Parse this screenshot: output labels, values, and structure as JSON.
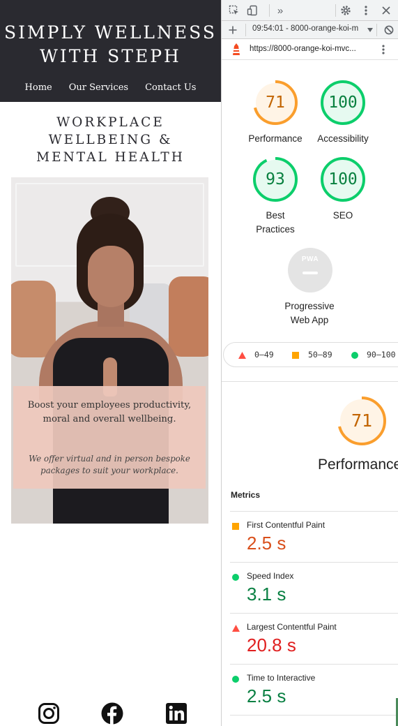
{
  "site": {
    "brand_line1": "SIMPLY WELLNESS",
    "brand_line2": "WITH STEPH",
    "nav": [
      {
        "label": "Home"
      },
      {
        "label": "Our Services"
      },
      {
        "label": "Contact Us"
      }
    ],
    "hero_line1": "WORKPLACE",
    "hero_line2": "WELLBEING &",
    "hero_line3": "MENTAL HEALTH",
    "overlay_p1": "Boost your employees productivity, moral and overall wellbeing.",
    "overlay_p2": "We offer virtual and in person bespoke packages to suit your workplace.",
    "social": [
      "instagram-icon",
      "facebook-icon",
      "linkedin-icon"
    ]
  },
  "devtools": {
    "more_tabs": "»",
    "report_label": "09:54:01 - 8000-orange-koi-m",
    "url": "https://8000-orange-koi-mvc...",
    "scores": {
      "performance": {
        "value": "71",
        "label": "Performance",
        "fraction": 0.71,
        "color": "#fa9e2d"
      },
      "accessibility": {
        "value": "100",
        "label": "Accessibility",
        "fraction": 1.0,
        "color": "#0cce6b"
      },
      "best_practices": {
        "value": "93",
        "label_line1": "Best",
        "label_line2": "Practices",
        "fraction": 0.93,
        "color": "#0cce6b"
      },
      "seo": {
        "value": "100",
        "label": "SEO",
        "fraction": 1.0,
        "color": "#0cce6b"
      }
    },
    "pwa": {
      "badge": "PWA",
      "label_line1": "Progressive",
      "label_line2": "Web App"
    },
    "legend": {
      "poor": "0–49",
      "average": "50–89",
      "good": "90–100"
    },
    "performance_big": {
      "value": "71",
      "title": "Performance",
      "fraction": 0.71
    },
    "metrics_title": "Metrics",
    "metrics": [
      {
        "name": "First Contentful Paint",
        "value": "2.5 s",
        "status": "average",
        "color": "#d94f1b"
      },
      {
        "name": "Speed Index",
        "value": "3.1 s",
        "status": "good",
        "color": "#0a8043"
      },
      {
        "name": "Largest Contentful Paint",
        "value": "20.8 s",
        "status": "poor",
        "color": "#e01f1f"
      },
      {
        "name": "Time to Interactive",
        "value": "2.5 s",
        "status": "good",
        "color": "#0a8043"
      }
    ]
  }
}
